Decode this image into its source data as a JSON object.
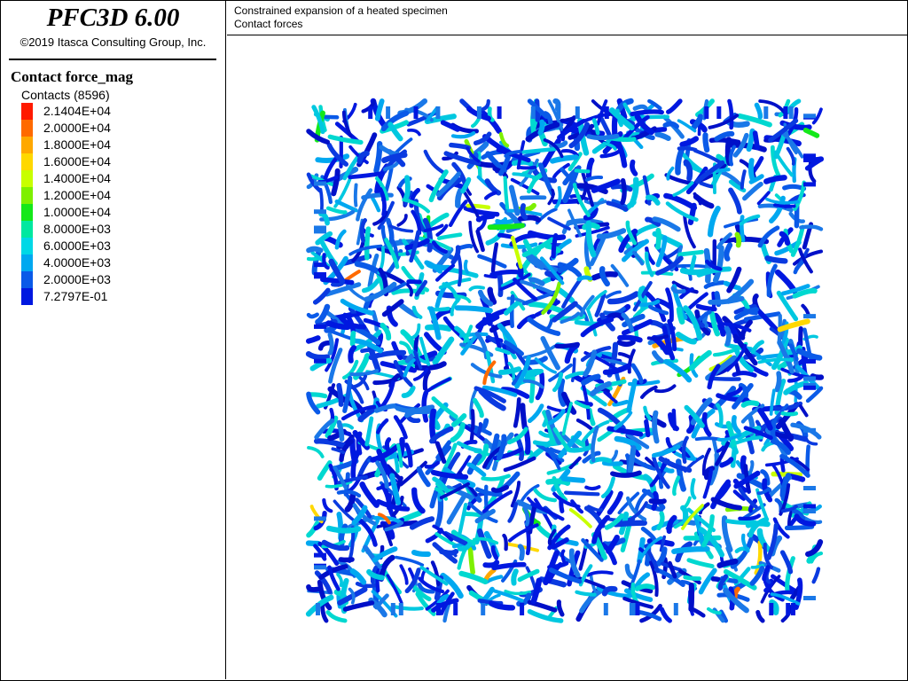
{
  "app": {
    "title": "PFC3D 6.00",
    "copyright": "©2019 Itasca Consulting Group, Inc."
  },
  "legend": {
    "title": "Contact force_mag",
    "subtitle": "Contacts (8596)",
    "items": [
      {
        "label": "2.1404E+04",
        "color": "#ff1a00"
      },
      {
        "label": "2.0000E+04",
        "color": "#ff6a00"
      },
      {
        "label": "1.8000E+04",
        "color": "#ffa800"
      },
      {
        "label": "1.6000E+04",
        "color": "#ffd800"
      },
      {
        "label": "1.4000E+04",
        "color": "#c8ff00"
      },
      {
        "label": "1.2000E+04",
        "color": "#7ef000"
      },
      {
        "label": "1.0000E+04",
        "color": "#14e81a"
      },
      {
        "label": "8.0000E+03",
        "color": "#00e8a0"
      },
      {
        "label": "6.0000E+03",
        "color": "#00d8e6"
      },
      {
        "label": "4.0000E+03",
        "color": "#00a8f0"
      },
      {
        "label": "2.0000E+03",
        "color": "#0a5ae8"
      },
      {
        "label": "7.2797E-01",
        "color": "#0018e0"
      }
    ]
  },
  "plot": {
    "title_line1": "Constrained expansion of a heated specimen",
    "title_line2": "Contact forces"
  }
}
